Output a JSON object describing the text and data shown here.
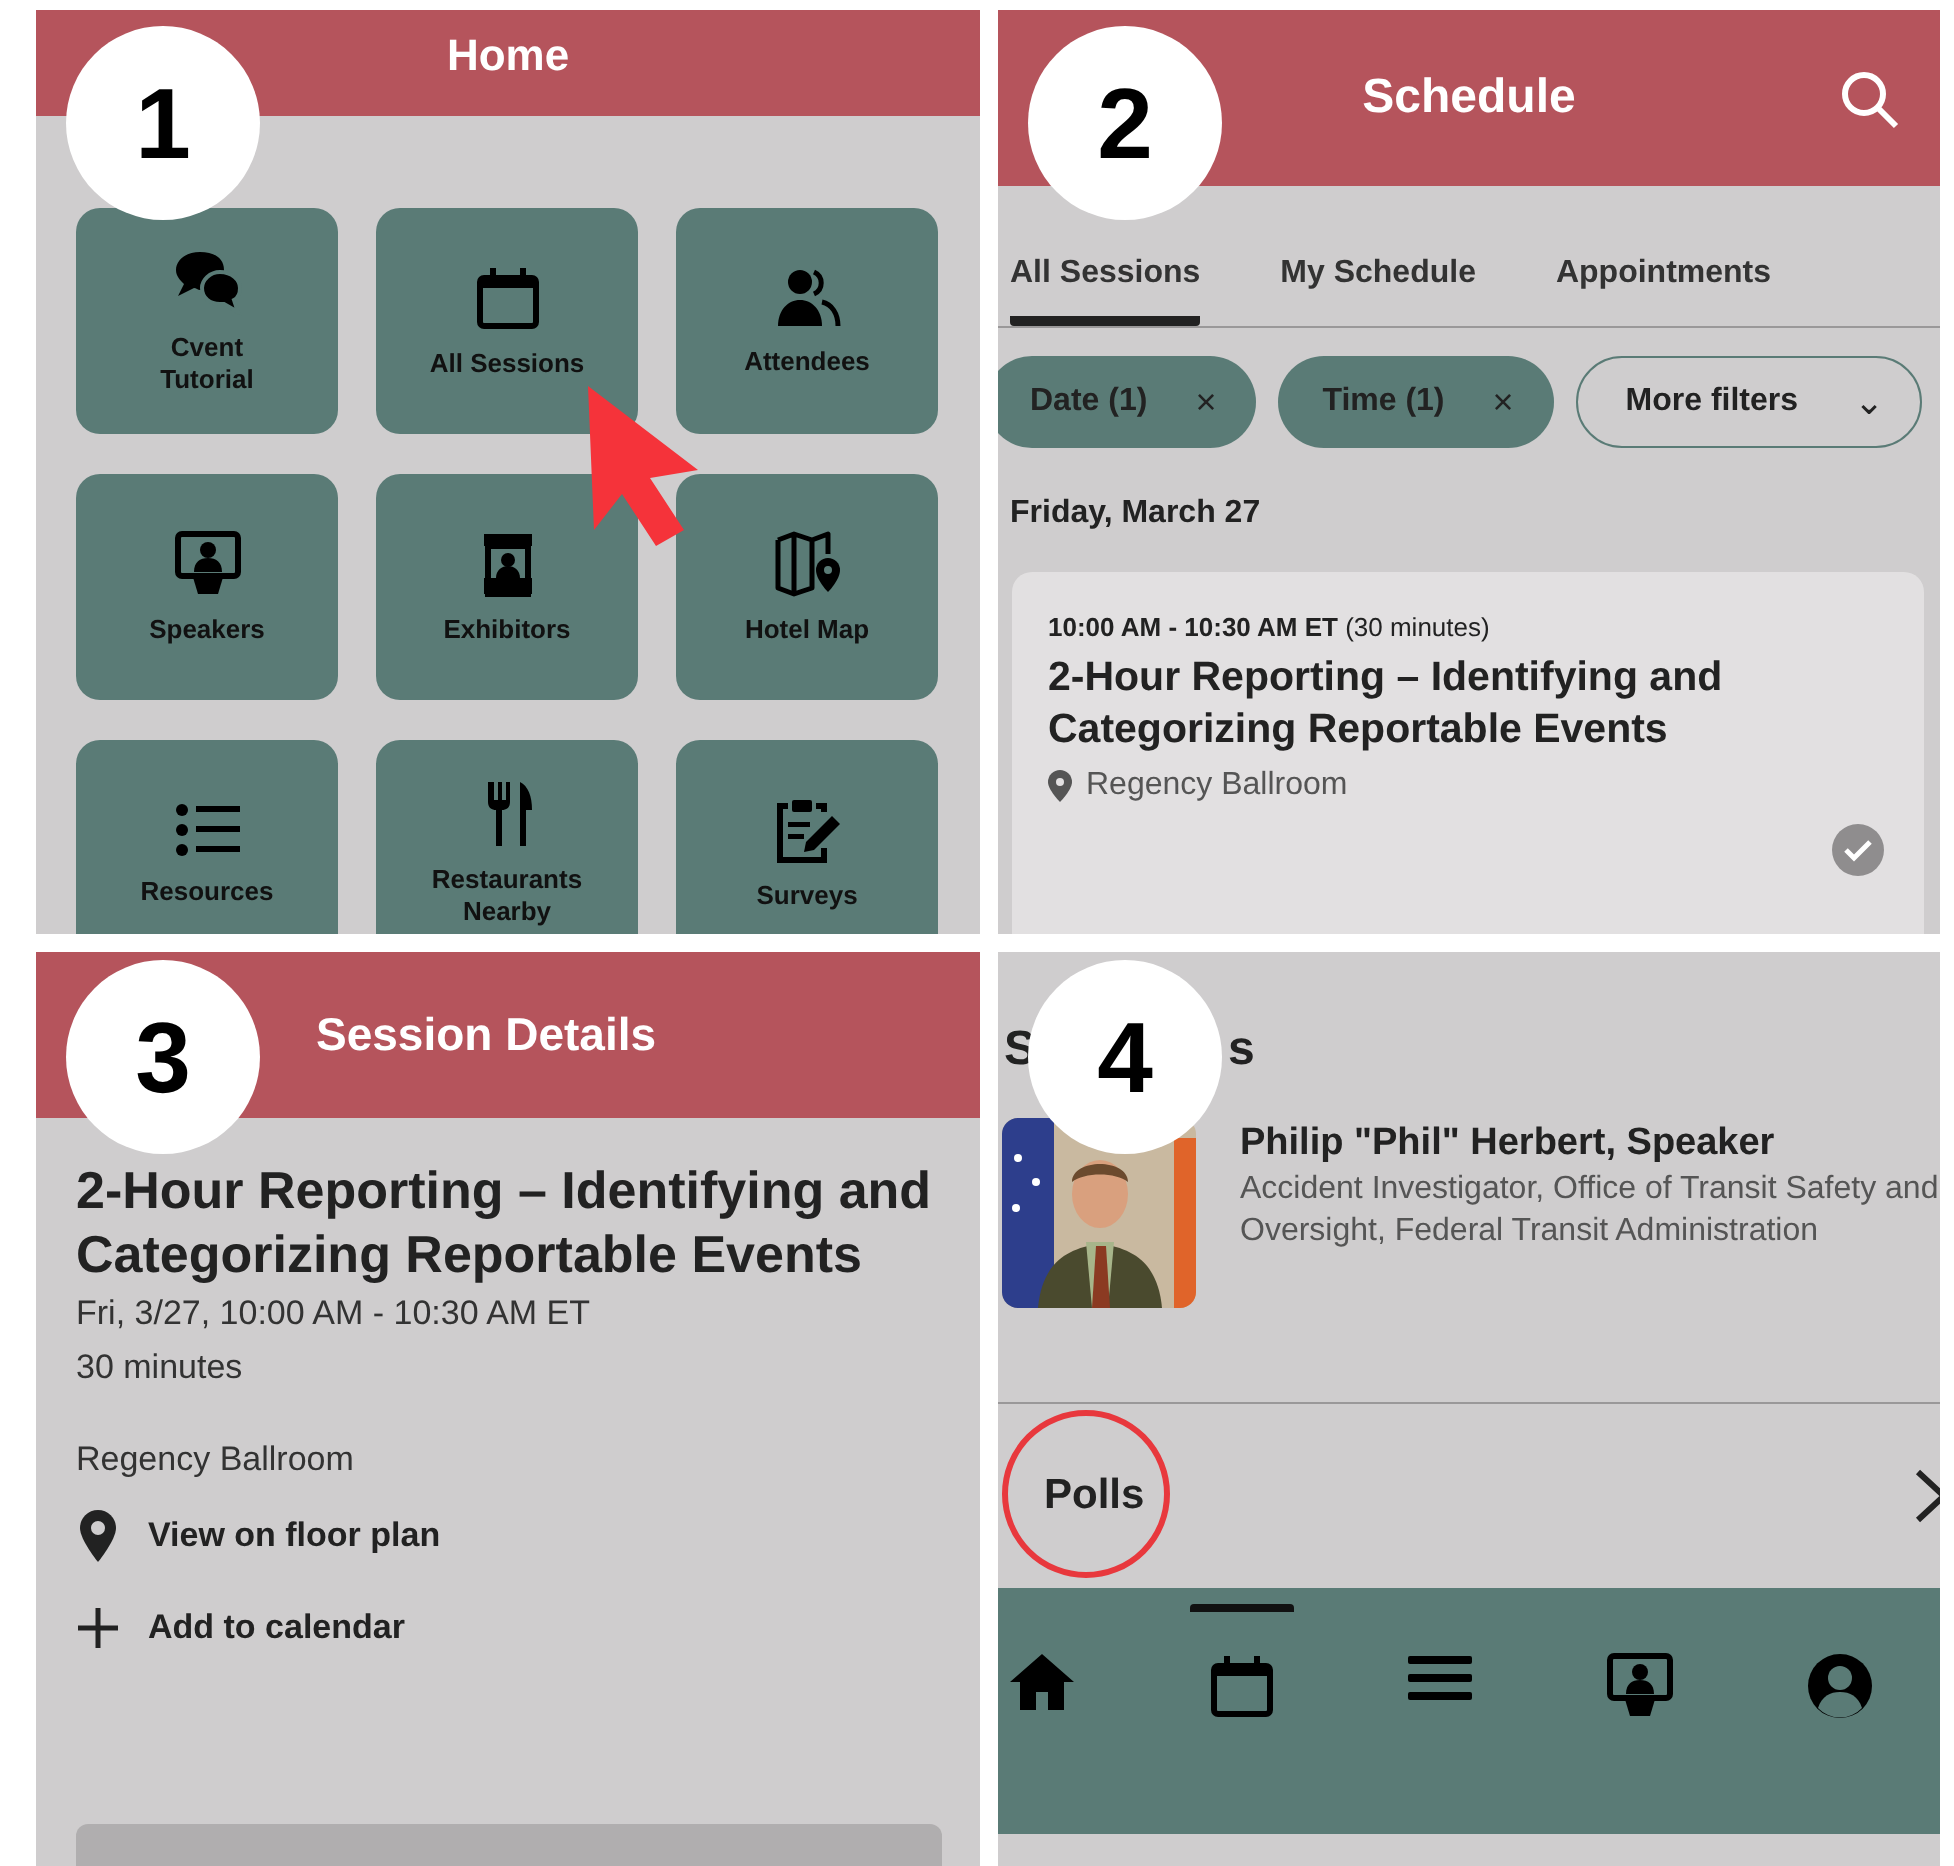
{
  "home": {
    "step": "1",
    "title": "Home",
    "tiles": [
      {
        "label": "Cvent\nTutorial",
        "pointed": false
      },
      {
        "label": "All Sessions",
        "pointed": true
      },
      {
        "label": "Attendees",
        "pointed": false
      },
      {
        "label": "Speakers",
        "pointed": false
      },
      {
        "label": "Exhibitors",
        "pointed": false
      },
      {
        "label": "Hotel Map",
        "pointed": false
      },
      {
        "label": "Resources",
        "pointed": false
      },
      {
        "label": "Restaurants\nNearby",
        "pointed": false
      },
      {
        "label": "Surveys",
        "pointed": false
      }
    ]
  },
  "schedule": {
    "step": "2",
    "title": "Schedule",
    "tabs": [
      {
        "label": "All Sessions",
        "selected": true
      },
      {
        "label": "My Schedule",
        "selected": false
      },
      {
        "label": "Appointments",
        "selected": false
      }
    ],
    "filters": [
      {
        "label": "Date (1)",
        "kind": "applied",
        "icon": "×"
      },
      {
        "label": "Time (1)",
        "kind": "applied",
        "icon": "×"
      },
      {
        "label": "More filters",
        "kind": "menu",
        "icon": "⌄"
      }
    ],
    "day": "Friday, March 27",
    "session": {
      "time": "**10:00 AM - 10:30 AM ET** (30 minutes)",
      "title": "2-Hour Reporting – Identifying and Categorizing Reportable Events",
      "location": "Regency Ballroom"
    }
  },
  "details": {
    "step": "3",
    "title": "Session Details",
    "session_title": "2-Hour Reporting – Identifying and Categorizing Reportable Events",
    "when": "Fri, 3/27, 10:00 AM - 10:30 AM ET",
    "duration": "30 minutes",
    "location": "Regency Ballroom",
    "actions": [
      {
        "label": "View on floor plan",
        "kind": "pin"
      },
      {
        "label": "Add to calendar",
        "kind": "plus"
      }
    ]
  },
  "speakers": {
    "step": "4",
    "heading_parts": [
      "S",
      "s"
    ],
    "speaker": {
      "name": "Philip \"Phil\" Herbert, Speaker",
      "title": "Accident Investigator, Office of Transit Safety and Oversight, Federal Transit Administration"
    },
    "polls": {
      "label": "Polls",
      "highlighted": true
    },
    "nav": [
      {
        "kind": "home",
        "selected": false
      },
      {
        "kind": "calendar",
        "selected": true
      },
      {
        "kind": "menu",
        "selected": false
      },
      {
        "kind": "presenter",
        "selected": false
      },
      {
        "kind": "profile",
        "selected": false
      }
    ]
  }
}
